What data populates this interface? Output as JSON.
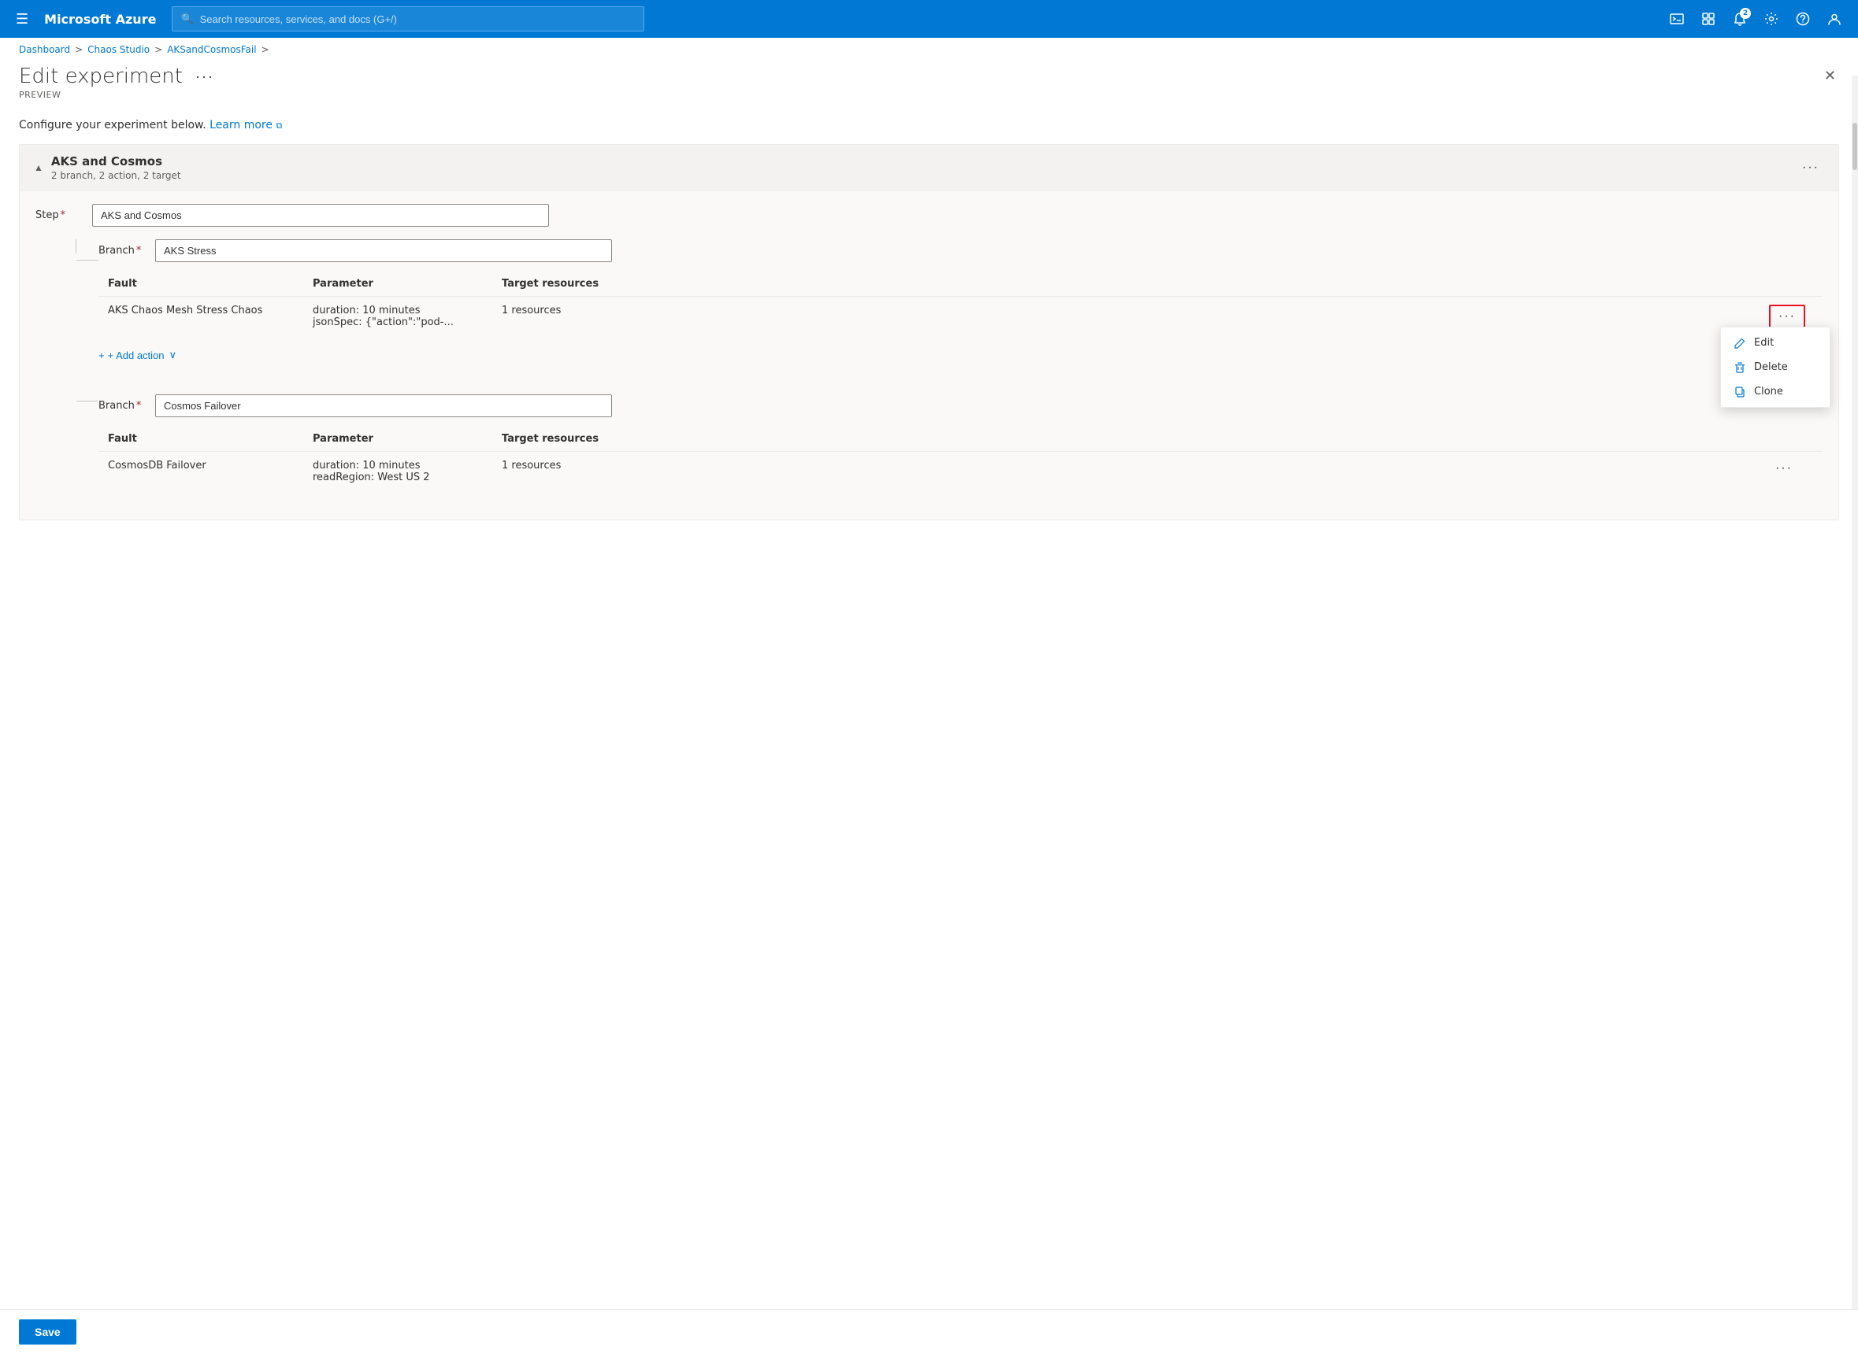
{
  "topbar": {
    "hamburger_label": "☰",
    "logo": "Microsoft Azure",
    "search_placeholder": "Search resources, services, and docs (G+/)",
    "icons": [
      {
        "id": "terminal-icon",
        "symbol": "⌨",
        "badge": null
      },
      {
        "id": "notifications-icon",
        "symbol": "🔔",
        "badge": "2"
      },
      {
        "id": "settings-icon",
        "symbol": "⚙",
        "badge": null
      },
      {
        "id": "help-icon",
        "symbol": "?",
        "badge": null
      },
      {
        "id": "profile-icon",
        "symbol": "👤",
        "badge": null
      }
    ]
  },
  "breadcrumb": {
    "items": [
      {
        "label": "Dashboard",
        "id": "crumb-dashboard"
      },
      {
        "label": "Chaos Studio",
        "id": "crumb-chaos-studio"
      },
      {
        "label": "AKSandCosmosFail",
        "id": "crumb-experiment"
      }
    ]
  },
  "page": {
    "title": "Edit experiment",
    "more_label": "···",
    "subtitle": "PREVIEW",
    "close_label": "✕",
    "info_text": "Configure your experiment below.",
    "learn_more": "Learn more",
    "learn_more_icon": "⧉"
  },
  "experiment": {
    "step_name": "AKS and Cosmos",
    "step_meta": "2 branch, 2 action, 2 target",
    "step_more_label": "···",
    "step_field_label": "Step",
    "step_field_value": "AKS and Cosmos",
    "step_field_more": "···",
    "branches": [
      {
        "id": "branch-aks",
        "label": "Branch",
        "name": "AKS Stress",
        "faults_header": [
          "Fault",
          "Parameter",
          "Target resources"
        ],
        "faults": [
          {
            "id": "fault-aks-stress",
            "name": "AKS Chaos Mesh Stress Chaos",
            "parameters": [
              "duration: 10 minutes",
              "jsonSpec: {\"action\":\"pod-..."
            ],
            "target_resources": "1 resources",
            "has_menu_open": true
          }
        ],
        "add_action_label": "+ Add action",
        "add_action_chevron": "∨"
      },
      {
        "id": "branch-cosmos",
        "label": "Branch",
        "name": "Cosmos Failover",
        "faults_header": [
          "Fault",
          "Parameter",
          "Target resources"
        ],
        "faults": [
          {
            "id": "fault-cosmos-failover",
            "name": "CosmosDB Failover",
            "parameters": [
              "duration: 10 minutes",
              "readRegion: West US 2"
            ],
            "target_resources": "1 resources",
            "has_menu_open": false
          }
        ]
      }
    ]
  },
  "context_menu": {
    "items": [
      {
        "id": "menu-edit",
        "label": "Edit",
        "icon": "✏"
      },
      {
        "id": "menu-delete",
        "label": "Delete",
        "icon": "🗑"
      },
      {
        "id": "menu-clone",
        "label": "Clone",
        "icon": "⧉"
      }
    ]
  },
  "save_bar": {
    "save_label": "Save"
  }
}
